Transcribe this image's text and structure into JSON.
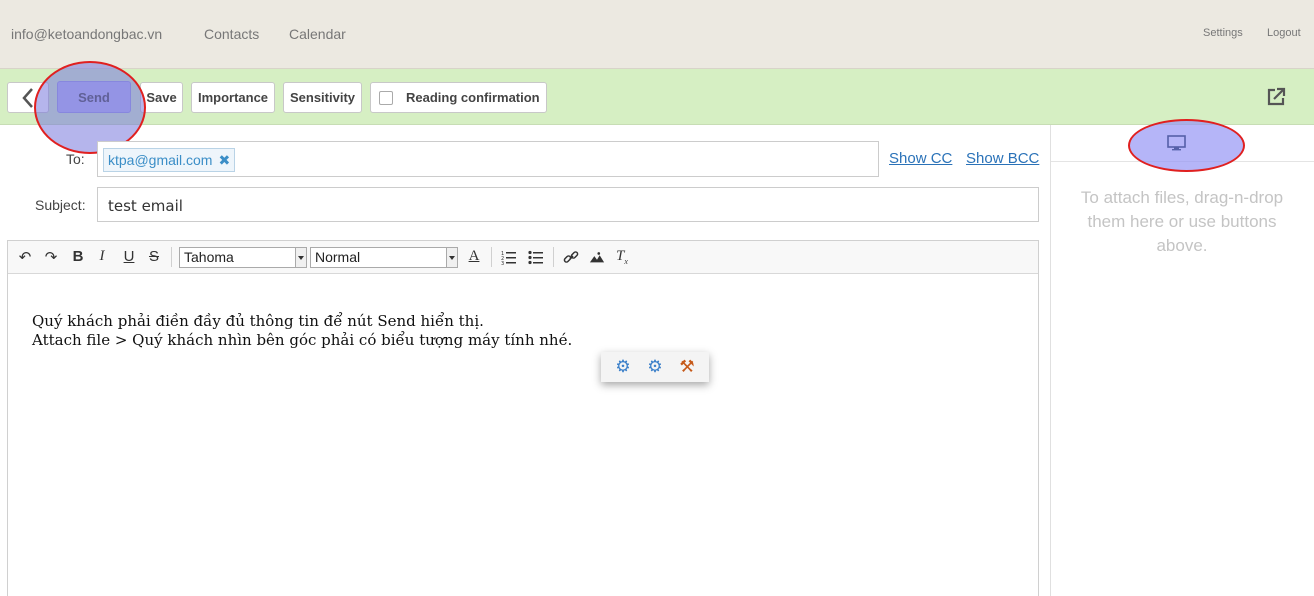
{
  "header": {
    "account": "info@ketoandongbac.vn",
    "nav": [
      "Contacts",
      "Calendar"
    ],
    "settings": "Settings",
    "logout": "Logout"
  },
  "toolbar": {
    "send": "Send",
    "save": "Save",
    "importance": "Importance",
    "sensitivity": "Sensitivity",
    "reading_confirmation": "Reading confirmation",
    "reading_confirmation_checked": false
  },
  "compose": {
    "to_label": "To:",
    "to_recipients": [
      "ktpa@gmail.com"
    ],
    "show_cc": "Show CC",
    "show_bcc": "Show BCC",
    "subject_label": "Subject:",
    "subject_value": "test email"
  },
  "editor": {
    "font_family": "Tahoma",
    "font_size": "Normal",
    "body_lines": [
      "Quý khách phải điền đầy đủ thông tin để nút Send hiển thị.",
      "Attach file > Quý khách nhìn bên góc phải có biểu tượng máy tính nhé."
    ]
  },
  "attachments": {
    "hint": "To attach files, drag-n-drop them here or use buttons above."
  },
  "colors": {
    "toolbar_bg": "#d6efc3",
    "header_bg": "#ece9e1",
    "link": "#2a72b8",
    "highlight_circle": "#e02020"
  }
}
